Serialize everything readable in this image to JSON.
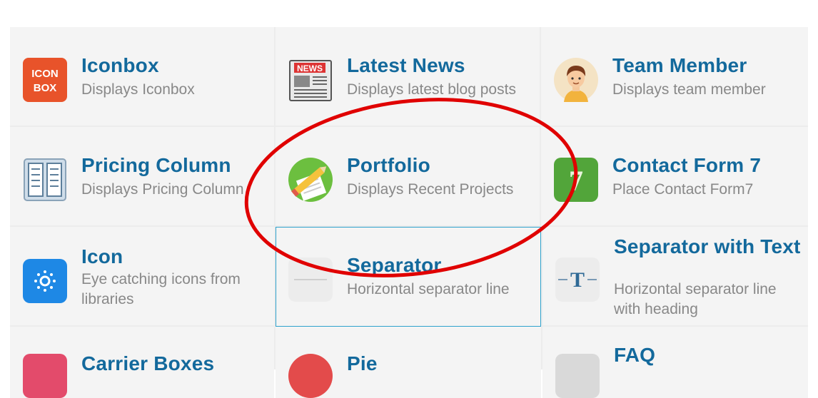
{
  "elements": [
    {
      "title": "Iconbox",
      "description": "Displays Iconbox",
      "icon": "iconbox-icon",
      "icon_text": [
        "ICON",
        "BOX"
      ]
    },
    {
      "title": "Latest News",
      "description": "Displays latest blog posts",
      "icon": "newspaper-icon",
      "icon_text": [
        "NEWS"
      ]
    },
    {
      "title": "Team Member",
      "description": "Displays team member",
      "icon": "person-avatar-icon"
    },
    {
      "title": "Pricing Column",
      "description": "Displays Pricing Column",
      "icon": "pricing-table-icon"
    },
    {
      "title": "Portfolio",
      "description": "Displays Recent Projects",
      "icon": "pencil-paper-icon"
    },
    {
      "title": "Contact Form 7",
      "description": "Place Contact Form7",
      "icon": "contact-form-7-icon",
      "icon_text": [
        "7"
      ]
    },
    {
      "title": "Icon",
      "description": "Eye catching icons from libraries",
      "icon": "sun-icon"
    },
    {
      "title": "Separator",
      "description": "Horizontal separator line",
      "icon": "separator-line-icon",
      "selected": true
    },
    {
      "title": "Separator with Text",
      "description": "Horizontal separator line with heading",
      "icon": "separator-text-icon",
      "icon_text": [
        "T"
      ]
    },
    {
      "title": "Carrier Boxes",
      "description": "",
      "icon": "partial-icon"
    },
    {
      "title": "Pie",
      "description": "",
      "icon": "partial-icon"
    },
    {
      "title": "FAQ",
      "description": "",
      "icon": "partial-icon"
    }
  ],
  "colors": {
    "title": "#13699c",
    "description": "#888888",
    "selection": "#2ea2cc",
    "annotation": "#e00000",
    "cell_bg": "#f4f4f4"
  }
}
